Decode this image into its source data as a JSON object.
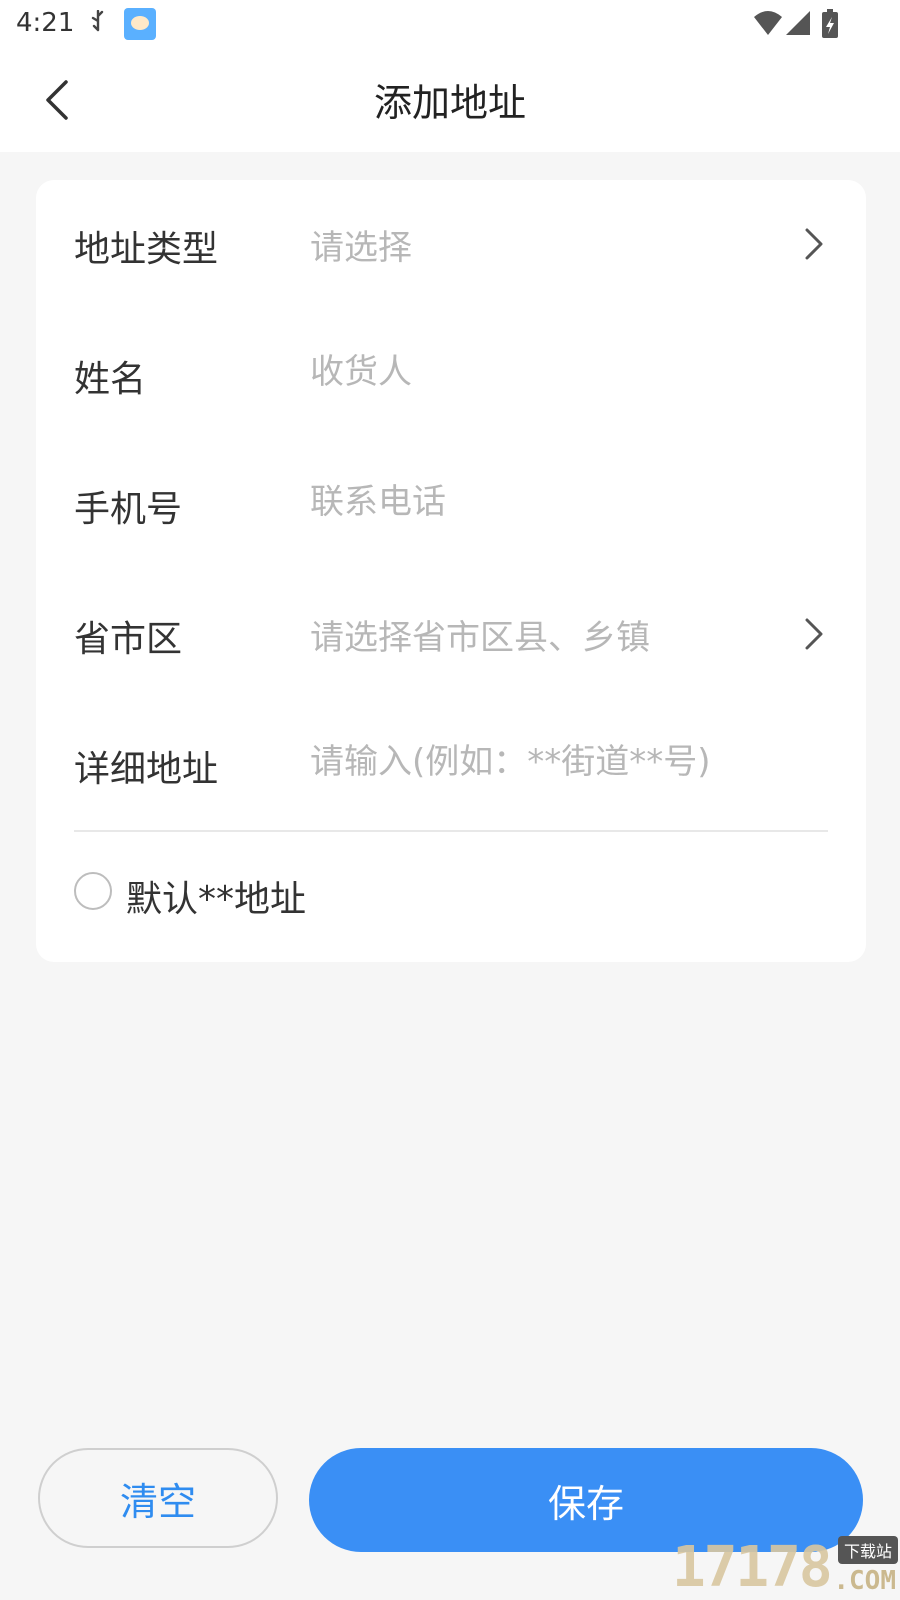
{
  "status_bar": {
    "time": "4:21",
    "notification_icons": [
      "usb-icon",
      "app-icon"
    ],
    "system_icons": [
      "wifi-icon",
      "signal-icon",
      "battery-charging-icon"
    ]
  },
  "nav": {
    "title": "添加地址",
    "back_icon": "chevron-left-icon"
  },
  "form": {
    "rows": [
      {
        "label": "地址类型",
        "placeholder": "请选择",
        "type": "select"
      },
      {
        "label": "姓名",
        "placeholder": "收货人",
        "type": "input"
      },
      {
        "label": "手机号",
        "placeholder": "联系电话",
        "type": "input"
      },
      {
        "label": "省市区",
        "placeholder": "请选择省市区县、乡镇",
        "type": "select"
      },
      {
        "label": "详细地址",
        "placeholder": "请输入(例如：**街道**号)",
        "type": "input"
      }
    ],
    "default_checkbox_label": "默认**地址"
  },
  "actions": {
    "clear_label": "清空",
    "save_label": "保存"
  },
  "watermark": {
    "digits": "17178",
    "badge": "下载站",
    "suffix": ".COM"
  },
  "colors": {
    "accent": "#3a8ff5",
    "clear_text": "#2f8cf0",
    "background": "#f6f6f6",
    "placeholder": "#b7b7b7"
  }
}
